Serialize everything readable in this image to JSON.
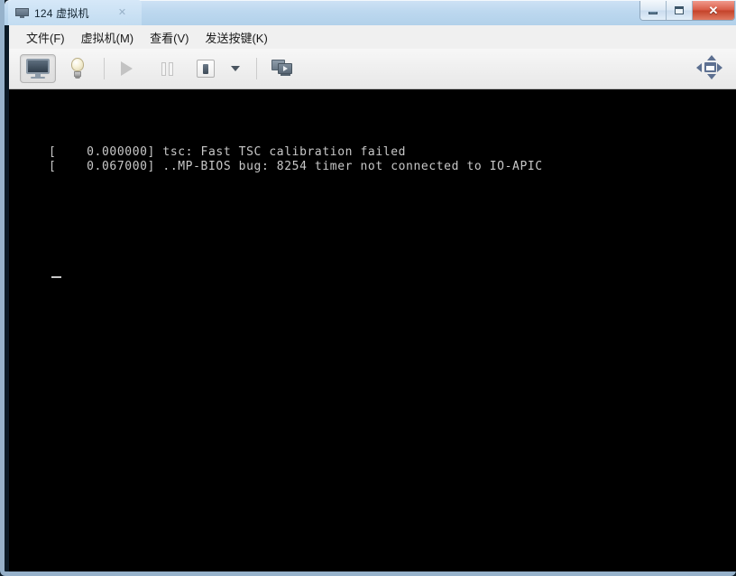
{
  "window": {
    "tab_title": "124 虚拟机",
    "tab_icon": "monitor-icon",
    "tab_close_glyph": "✕",
    "controls": {
      "minimize_label": "最小化",
      "maximize_label": "最大化",
      "close_glyph": "✕"
    },
    "border_color": "#afcde8",
    "titlebar_color": "#bdd8ef"
  },
  "menubar": {
    "items": [
      {
        "label": "文件(F)",
        "name": "menu-file"
      },
      {
        "label": "虚拟机(M)",
        "name": "menu-vm"
      },
      {
        "label": "查看(V)",
        "name": "menu-view"
      },
      {
        "label": "发送按键(K)",
        "name": "menu-send-key"
      }
    ]
  },
  "toolbar": {
    "buttons": [
      {
        "name": "console-view-button",
        "icon": "monitor-icon",
        "state": "active"
      },
      {
        "name": "show-hints-button",
        "icon": "lightbulb-icon",
        "state": "normal"
      },
      {
        "name": "power-on-button",
        "icon": "play-icon",
        "state": "disabled"
      },
      {
        "name": "pause-button",
        "icon": "pause-icon",
        "state": "disabled"
      },
      {
        "name": "shutdown-button",
        "icon": "stop-icon",
        "state": "normal"
      },
      {
        "name": "shutdown-dropdown-button",
        "icon": "chevron-down-icon",
        "state": "normal"
      },
      {
        "name": "unity-mode-button",
        "icon": "multi-monitor-icon",
        "state": "normal"
      },
      {
        "name": "fullscreen-button",
        "icon": "fullscreen-arrows-icon",
        "state": "normal"
      }
    ]
  },
  "console": {
    "background": "#000000",
    "foreground": "#c8c8c8",
    "lines": [
      "[    0.000000] tsc: Fast TSC calibration failed",
      "[    0.067000] ..MP-BIOS bug: 8254 timer not connected to IO-APIC"
    ],
    "text": "[    0.000000] tsc: Fast TSC calibration failed\n[    0.067000] ..MP-BIOS bug: 8254 timer not connected to IO-APIC",
    "cursor_visible": true
  }
}
